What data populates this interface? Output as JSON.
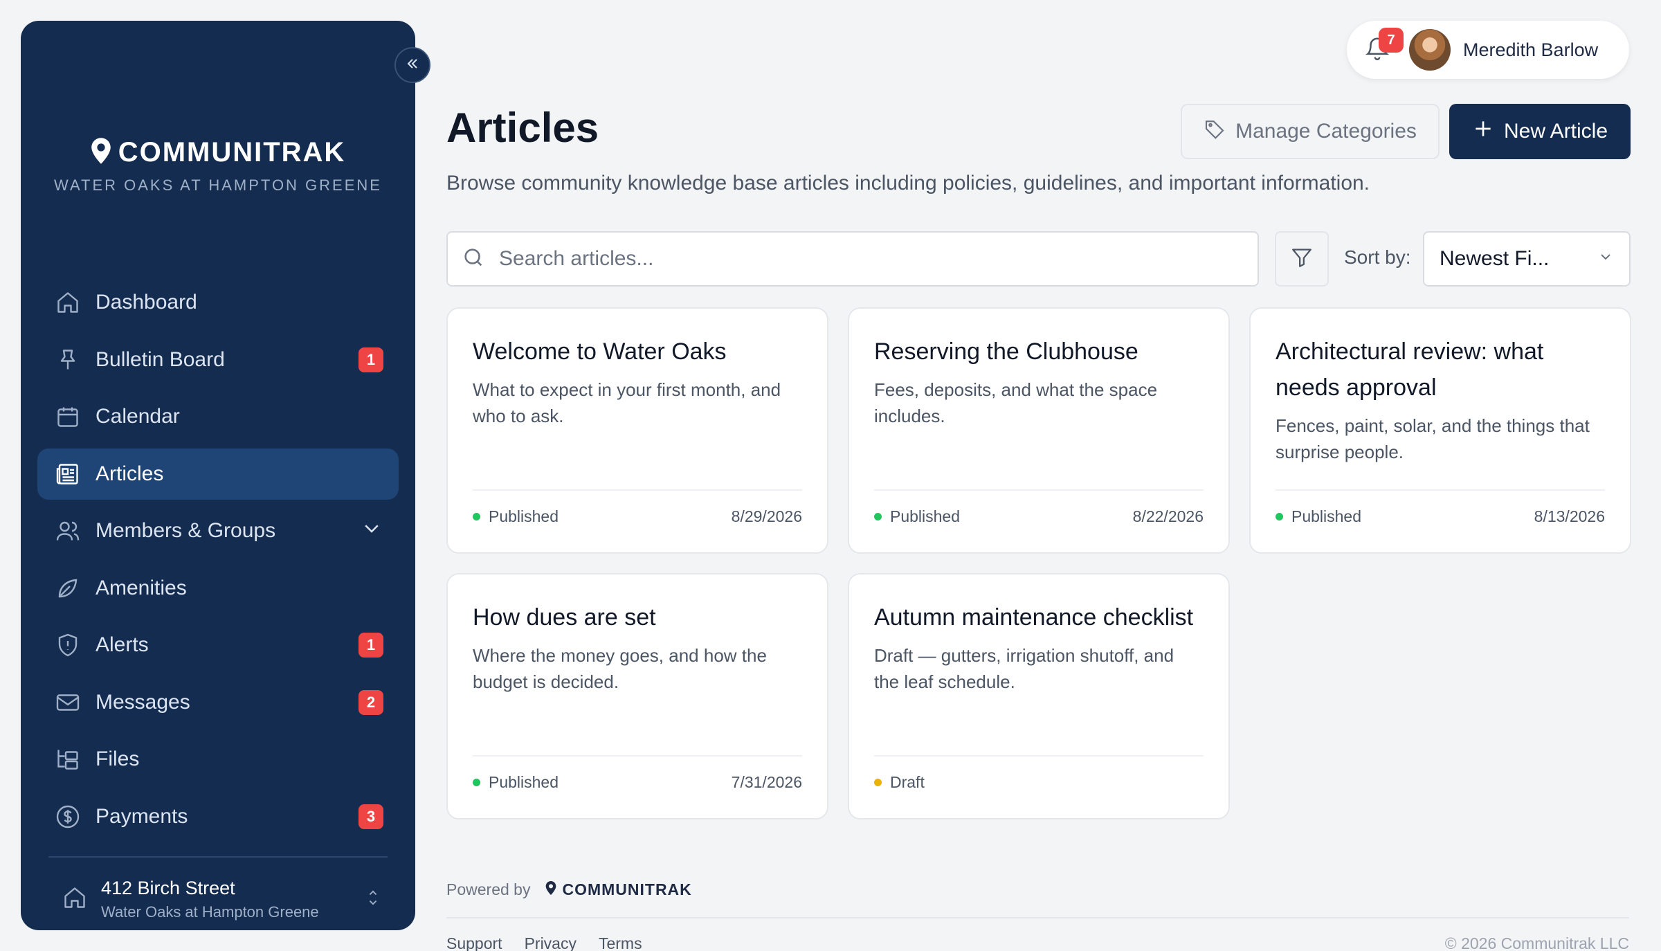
{
  "brand": {
    "name": "COMMUNITRAK",
    "community": "WATER OAKS AT HAMPTON GREENE"
  },
  "sidebar": {
    "items": [
      {
        "label": "Dashboard",
        "icon": "home-icon",
        "badge": ""
      },
      {
        "label": "Bulletin Board",
        "icon": "pin-icon",
        "badge": "1"
      },
      {
        "label": "Calendar",
        "icon": "calendar-icon",
        "badge": ""
      },
      {
        "label": "Articles",
        "icon": "newspaper-icon",
        "badge": "",
        "active": true
      },
      {
        "label": "Members & Groups",
        "icon": "users-icon",
        "badge": ""
      },
      {
        "label": "Amenities",
        "icon": "leaf-icon",
        "badge": ""
      },
      {
        "label": "Alerts",
        "icon": "shield-alert-icon",
        "badge": "1"
      },
      {
        "label": "Messages",
        "icon": "mail-icon",
        "badge": "2"
      },
      {
        "label": "Files",
        "icon": "folder-tree-icon",
        "badge": ""
      },
      {
        "label": "Payments",
        "icon": "dollar-circle-icon",
        "badge": "3"
      }
    ],
    "address": {
      "street": "412 Birch Street",
      "community": "Water Oaks at Hampton Greene"
    }
  },
  "user": {
    "name": "Meredith Barlow",
    "notifications": "7"
  },
  "header": {
    "title": "Articles",
    "description": "Browse community knowledge base articles including policies, guidelines, and important information.",
    "manage_label": "Manage Categories",
    "new_label": "New Article"
  },
  "toolbar": {
    "search_placeholder": "Search articles...",
    "sort_label": "Sort by:",
    "sort_value": "Newest Fi..."
  },
  "articles": [
    {
      "title": "Welcome to Water Oaks",
      "description": "What to expect in your first month, and who to ask.",
      "status": "Published",
      "date": "8/29/2026"
    },
    {
      "title": "Reserving the Clubhouse",
      "description": "Fees, deposits, and what the space includes.",
      "status": "Published",
      "date": "8/22/2026"
    },
    {
      "title": "Architectural review: what needs approval",
      "description": "Fences, paint, solar, and the things that surprise people.",
      "status": "Published",
      "date": "8/13/2026"
    },
    {
      "title": "How dues are set",
      "description": "Where the money goes, and how the budget is decided.",
      "status": "Published",
      "date": "7/31/2026"
    },
    {
      "title": "Autumn maintenance checklist",
      "description": "Draft — gutters, irrigation shutoff, and the leaf schedule.",
      "status": "Draft",
      "date": ""
    }
  ],
  "colors": {
    "sidebar": "#142c4f",
    "active": "#1f4576",
    "published": "#22c55e",
    "draft": "#eab308",
    "badge": "#ef4444"
  },
  "footer": {
    "powered_by": "Powered by",
    "brand": "COMMUNITRAK",
    "links": [
      "Support",
      "Privacy",
      "Terms"
    ],
    "copyright": "© 2026 Communitrak LLC"
  }
}
